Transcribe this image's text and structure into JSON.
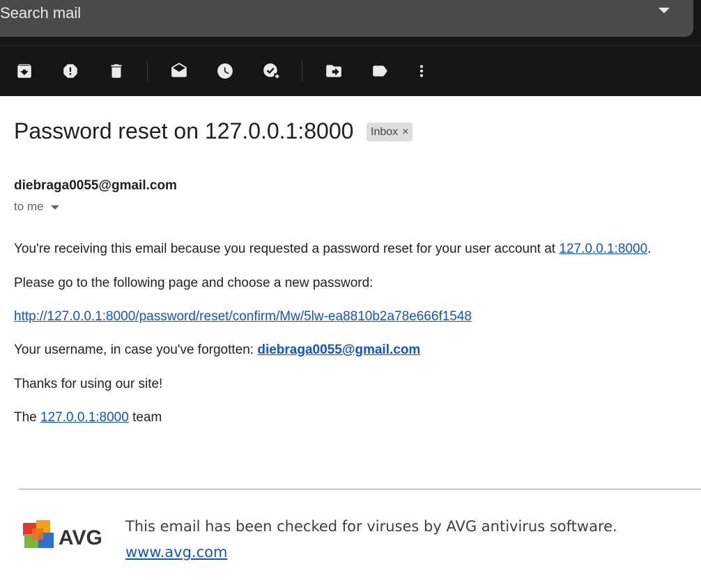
{
  "search": {
    "placeholder": "Search mail"
  },
  "toolbar": {
    "icons": [
      "archive-icon",
      "report-spam-icon",
      "delete-icon",
      "mark-unread-icon",
      "snooze-icon",
      "add-to-tasks-icon",
      "move-to-icon",
      "label-icon",
      "more-options-icon"
    ]
  },
  "email": {
    "subject": "Password reset on 127.0.0.1:8000",
    "label": "Inbox",
    "label_remove": "×",
    "sender": "diebraga0055@gmail.com",
    "recipient": "to me",
    "body": {
      "line1_text": "You're receiving this email because you requested a password reset for your user account at ",
      "line1_link": "127.0.0.1:8000",
      "line1_end": ".",
      "line2": "Please go to the following page and choose a new password:",
      "reset_link": "http://127.0.0.1:8000/password/reset/confirm/Mw/5lw-ea8810b2a78e666f1548",
      "line4_text": "Your username, in case you've forgotten: ",
      "line4_link": "diebraga0055@gmail.com",
      "line5": "Thanks for using our site!",
      "line6_pre": "The ",
      "line6_link": "127.0.0.1:8000",
      "line6_post": " team"
    },
    "footer": {
      "logo_text": "AVG",
      "notice": "This email has been checked for viruses by AVG antivirus software.",
      "link": "www.avg.com"
    }
  },
  "colors": {
    "toolbar_bg": "#161616",
    "search_bg": "#4a4a4a",
    "link": "#1155cc",
    "chip_bg": "#dddddd"
  }
}
